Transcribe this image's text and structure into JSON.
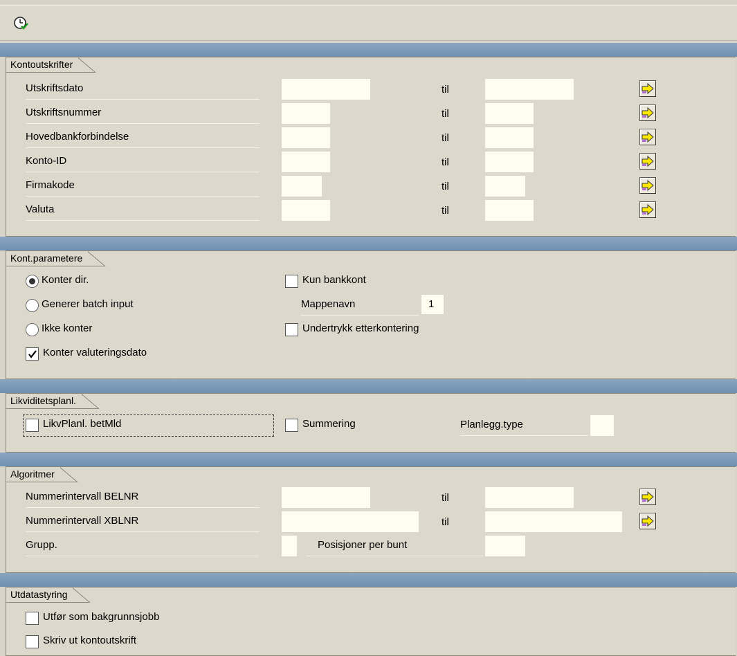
{
  "toolbar": {
    "execute_icon": "execute-clock-icon"
  },
  "groups": {
    "kontoutskrifter": {
      "title": "Kontoutskrifter",
      "til": "til",
      "rows": [
        {
          "label": "Utskriftsdato"
        },
        {
          "label": "Utskriftsnummer"
        },
        {
          "label": "Hovedbankforbindelse"
        },
        {
          "label": "Konto-ID"
        },
        {
          "label": "Firmakode"
        },
        {
          "label": "Valuta"
        }
      ]
    },
    "kont_parametere": {
      "title": "Kont.parametere",
      "radio_direct": "Konter dir.",
      "radio_batch": "Generer batch input",
      "radio_none": "Ikke konter",
      "check_value_date": "Konter valuteringsdato",
      "check_bank_only": "Kun bankkont",
      "folder_label": "Mappenavn",
      "folder_value": "1",
      "check_suppress": "Undertrykk etterkontering"
    },
    "likviditet": {
      "title": "Likviditetsplanl.",
      "check_liq": "LikvPlanl. betMld",
      "check_sum": "Summering",
      "plan_type_label": "Planlegg.type"
    },
    "algoritmer": {
      "title": "Algoritmer",
      "til": "til",
      "belnr": "Nummerintervall BELNR",
      "xblnr": "Nummerintervall XBLNR",
      "grupp": "Grupp.",
      "pos_bunt": "Posisjoner per bunt"
    },
    "utdata": {
      "title": "Utdatastyring",
      "check_bg": "Utfør som bakgrunnsjobb",
      "check_print": "Skriv ut kontoutskrift"
    }
  },
  "colors": {
    "input_bg": "#fffdf0",
    "separator": "#7a98b6",
    "panel": "#dcd8cc"
  }
}
